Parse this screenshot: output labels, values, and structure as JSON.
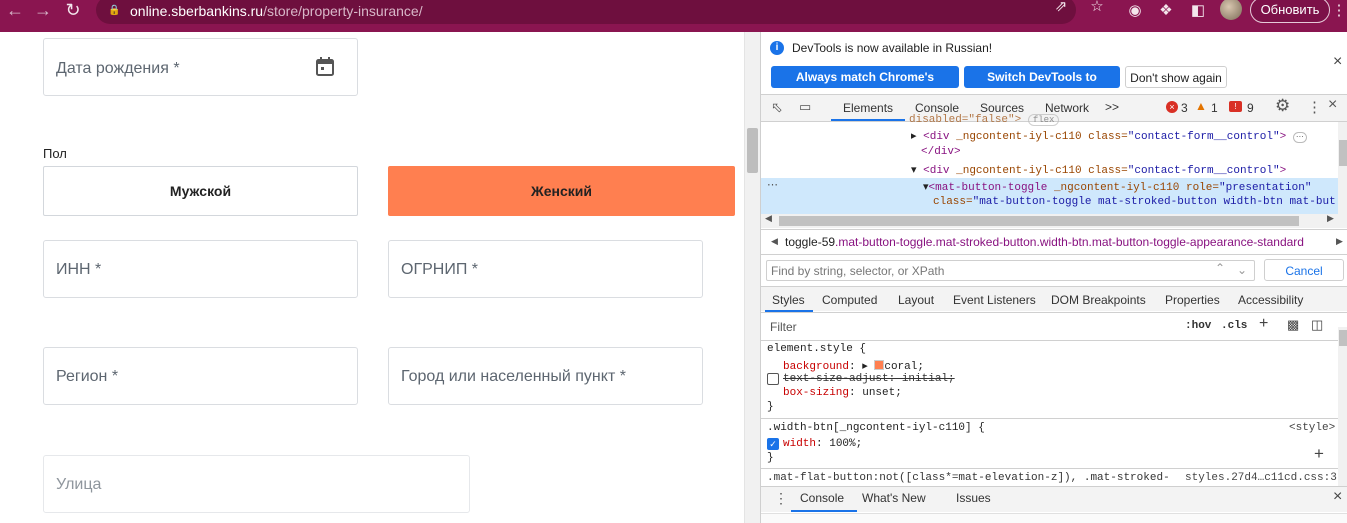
{
  "browser": {
    "url_host": "online.sberbankins.ru",
    "url_path": "/store/property-insurance/",
    "update_label": "Обновить"
  },
  "form": {
    "dob_label": "Дата рождения *",
    "gender_label": "Пол",
    "male_label": "Мужской",
    "female_label": "Женский",
    "inn_label": "ИНН *",
    "ogrnip_label": "ОГРНИП *",
    "region_label": "Регион *",
    "city_label": "Город или населенный пункт *",
    "street_label": "Улица",
    "female_color": "#ff7f50"
  },
  "devtools": {
    "banner": {
      "message": "DevTools is now available in Russian!",
      "match_btn": "Always match Chrome's language",
      "switch_btn": "Switch DevTools to Russian",
      "dont_show_btn": "Don't show again"
    },
    "tabs": [
      "Elements",
      "Console",
      "Sources",
      "Network"
    ],
    "more_tabs": ">>",
    "errors": "3",
    "warnings": "1",
    "issues": "9",
    "dom": {
      "line0": "disabled=\"false\">",
      "line0_badge": "flex",
      "line1_tag": "<div",
      "line1_attrs": " _ngcontent-iyl-c110 class=",
      "line1_val": "\"contact-form__control\"",
      "line1_end": ">",
      "line2": "</div>",
      "line3_tag": "<div",
      "line3_attrs": " _ngcontent-iyl-c110 class=",
      "line3_val": "\"contact-form__control\"",
      "line3_end": ">",
      "line4_tag": "<mat-button-toggle",
      "line4_attrs": " _ngcontent-iyl-c110 role=",
      "line4_val": "\"presentation\"",
      "line5_attr": "class=",
      "line5_val": "\"mat-button-toggle mat-stroked-button width-btn mat-but"
    },
    "breadcrumb_id": "toggle-59",
    "breadcrumb_rest": ".mat-button-toggle.mat-stroked-button.width-btn.mat-button-toggle-appearance-standard",
    "search_placeholder": "Find by string, selector, or XPath",
    "cancel_label": "Cancel",
    "styles_tabs": [
      "Styles",
      "Computed",
      "Layout",
      "Event Listeners",
      "DOM Breakpoints",
      "Properties",
      "Accessibility"
    ],
    "filter_placeholder": "Filter",
    "hov": ":hov",
    "cls": ".cls",
    "rules": {
      "element_style": "element.style {",
      "prop1": "background",
      "val1": "coral;",
      "prop2": "text-size-adjust: initial;",
      "prop3": "box-sizing",
      "val3": "unset;",
      "close": "}",
      "rule2_selector": ".width-btn[_ngcontent-iyl-c110] {",
      "rule2_source": "<style>",
      "rule2_prop": "width",
      "rule2_val": "100%;",
      "rule3_selector": ".mat-flat-button:not([class*=mat-elevation-z]), .mat-stroked-",
      "rule3_source": "styles.27d4…c11cd.css:3"
    },
    "drawer_tabs": [
      "Console",
      "What's New",
      "Issues"
    ]
  }
}
